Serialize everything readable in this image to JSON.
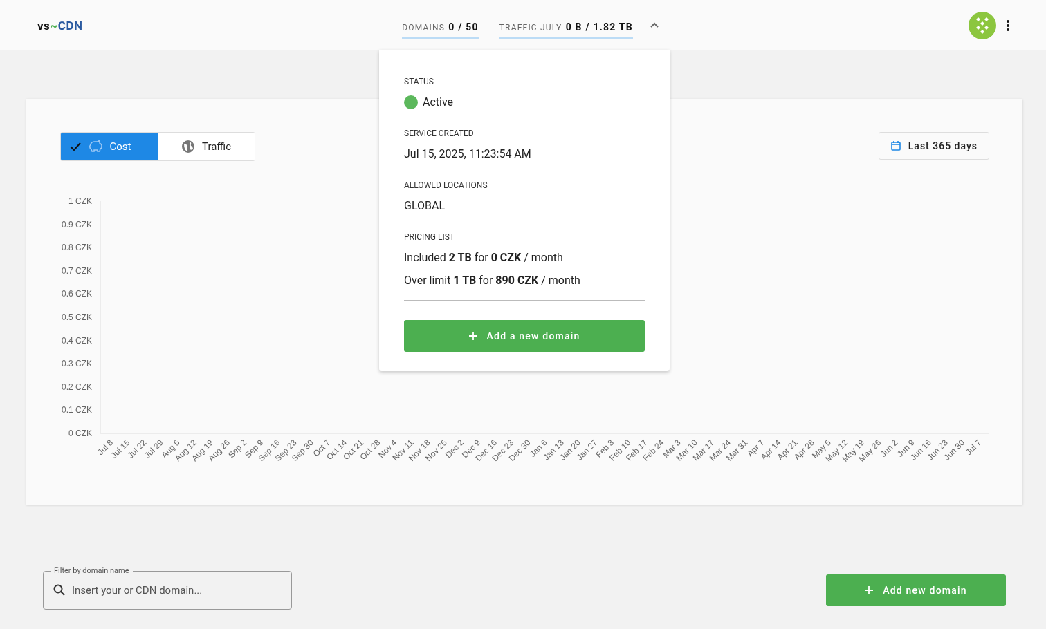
{
  "header": {
    "logo": {
      "prefix": "vs",
      "tilde": "~",
      "name": "CDN"
    },
    "stats": [
      {
        "label": "DOMAINS",
        "value": "0 / 50"
      },
      {
        "label": "TRAFFIC JULY",
        "value": "0 B / 1.82 TB"
      }
    ],
    "expanded": true
  },
  "popup": {
    "sections": [
      {
        "kind": "status",
        "label": "STATUS",
        "value": "Active",
        "color": "#5cb85c"
      },
      {
        "kind": "text",
        "label": "SERVICE CREATED",
        "value": "Jul 15, 2025, 11:23:54 AM"
      },
      {
        "kind": "text",
        "label": "ALLOWED LOCATIONS",
        "value": "GLOBAL"
      },
      {
        "kind": "lines",
        "label": "PRICING LIST",
        "lines": [
          "Included **2 TB** for **0 CZK** / month",
          "Over limit **1 TB** for **890 CZK** / month"
        ]
      }
    ],
    "button": "Add a new domain"
  },
  "toggle": [
    {
      "kind": "cost",
      "label": "Cost",
      "selected": true
    },
    {
      "kind": "traffic",
      "label": "Traffic",
      "selected": false
    }
  ],
  "range_button": "Last 365 days",
  "chart_data": {
    "type": "line",
    "ylim": [
      0,
      1
    ],
    "yticks": [
      {
        "value": 0,
        "label": "0 CZK"
      },
      {
        "value": 0.1,
        "label": "0.1 CZK"
      },
      {
        "value": 0.2,
        "label": "0.2 CZK"
      },
      {
        "value": 0.3,
        "label": "0.3 CZK"
      },
      {
        "value": 0.4,
        "label": "0.4 CZK"
      },
      {
        "value": 0.5,
        "label": "0.5 CZK"
      },
      {
        "value": 0.6,
        "label": "0.6 CZK"
      },
      {
        "value": 0.7,
        "label": "0.7 CZK"
      },
      {
        "value": 0.8,
        "label": "0.8 CZK"
      },
      {
        "value": 0.9,
        "label": "0.9 CZK"
      },
      {
        "value": 1,
        "label": "1 CZK"
      }
    ],
    "categories": [
      "Jul 8",
      "Jul 15",
      "Jul 22",
      "Jul 29",
      "Aug 5",
      "Aug 12",
      "Aug 19",
      "Aug 26",
      "Sep 2",
      "Sep 9",
      "Sep 16",
      "Sep 23",
      "Sep 30",
      "Oct 7",
      "Oct 14",
      "Oct 21",
      "Oct 28",
      "Nov 4",
      "Nov 11",
      "Nov 18",
      "Nov 25",
      "Dec 2",
      "Dec 9",
      "Dec 16",
      "Dec 23",
      "Dec 30",
      "Jan 6",
      "Jan 13",
      "Jan 20",
      "Jan 27",
      "Feb 3",
      "Feb 10",
      "Feb 17",
      "Feb 24",
      "Mar 3",
      "Mar 10",
      "Mar 17",
      "Mar 24",
      "Mar 31",
      "Apr 7",
      "Apr 14",
      "Apr 21",
      "Apr 28",
      "May 5",
      "May 12",
      "May 19",
      "May 26",
      "Jun 2",
      "Jun 9",
      "Jun 16",
      "Jun 23",
      "Jun 30",
      "Jul 7"
    ]
  },
  "filter": {
    "label": "Filter by domain name",
    "placeholder": "Insert your or CDN domain..."
  },
  "add_button": "Add new domain"
}
